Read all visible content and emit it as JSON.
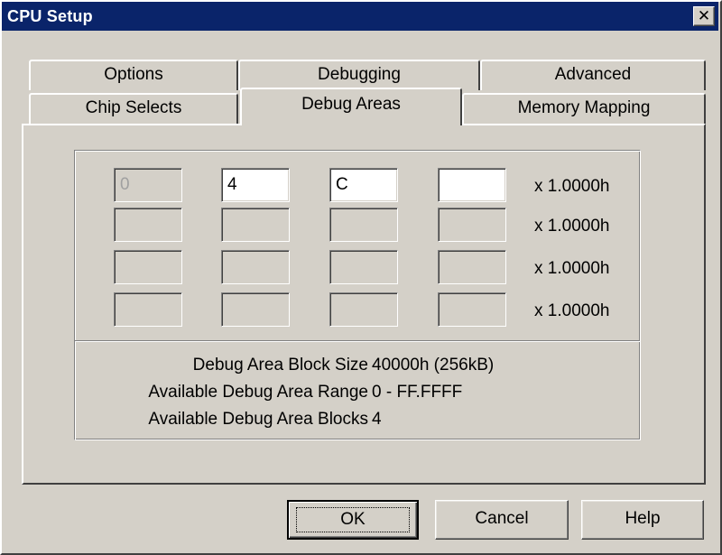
{
  "window": {
    "title": "CPU Setup",
    "close_glyph": "✕"
  },
  "tabs": {
    "back_row": [
      "Options",
      "Debugging",
      "Advanced"
    ],
    "front_row": [
      "Chip Selects",
      "Debug Areas",
      "Memory Mapping"
    ],
    "active": "Debug Areas"
  },
  "debug_areas": {
    "rows": [
      {
        "fields": [
          "0",
          "4",
          "C",
          ""
        ],
        "unit": "x 1.0000h"
      },
      {
        "fields": [
          "",
          "",
          "",
          ""
        ],
        "unit": "x 1.0000h"
      },
      {
        "fields": [
          "",
          "",
          "",
          ""
        ],
        "unit": "x 1.0000h"
      },
      {
        "fields": [
          "",
          "",
          "",
          ""
        ],
        "unit": "x 1.0000h"
      }
    ],
    "info": [
      {
        "label": "Debug Area Block Size",
        "value": "40000h (256kB)"
      },
      {
        "label": "Available Debug Area Range",
        "value": "0 - FF.FFFF"
      },
      {
        "label": "Available Debug Area Blocks",
        "value": "4"
      }
    ]
  },
  "buttons": {
    "ok": "OK",
    "cancel": "Cancel",
    "help": "Help"
  }
}
